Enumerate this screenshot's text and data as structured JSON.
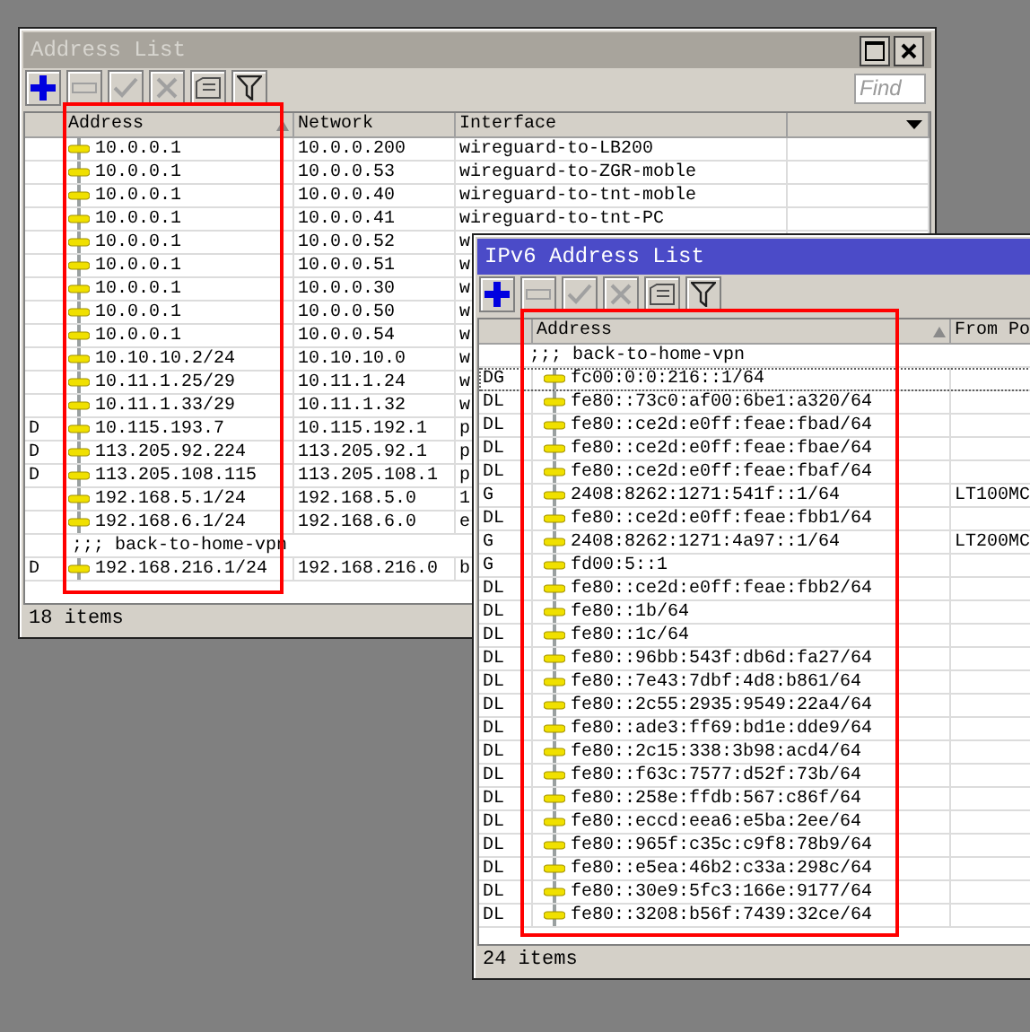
{
  "address_list": {
    "title": "Address List",
    "active": false,
    "toolbar": [
      {
        "kind": "add",
        "disabled": false
      },
      {
        "kind": "remove",
        "disabled": true
      },
      {
        "kind": "enable",
        "disabled": true
      },
      {
        "kind": "disable",
        "disabled": true
      },
      {
        "kind": "comment",
        "disabled": false
      },
      {
        "kind": "filter",
        "disabled": false
      }
    ],
    "find": {
      "placeholder": "Find"
    },
    "columns": [
      {
        "label": "Address",
        "sorted": true
      },
      {
        "label": "Network",
        "sorted": false
      },
      {
        "label": "Interface",
        "sorted": false
      }
    ],
    "rows": [
      {
        "kind": "entry",
        "address": "10.0.0.1",
        "network": "10.0.0.200",
        "interface": "wireguard-to-LB200"
      },
      {
        "kind": "entry",
        "address": "10.0.0.1",
        "network": "10.0.0.53",
        "interface": "wireguard-to-ZGR-moble"
      },
      {
        "kind": "entry",
        "address": "10.0.0.1",
        "network": "10.0.0.40",
        "interface": "wireguard-to-tnt-moble"
      },
      {
        "kind": "entry",
        "address": "10.0.0.1",
        "network": "10.0.0.41",
        "interface": "wireguard-to-tnt-PC"
      },
      {
        "kind": "entry",
        "address": "10.0.0.1",
        "network": "10.0.0.52",
        "interface": "w"
      },
      {
        "kind": "entry",
        "address": "10.0.0.1",
        "network": "10.0.0.51",
        "interface": "w"
      },
      {
        "kind": "entry",
        "address": "10.0.0.1",
        "network": "10.0.0.30",
        "interface": "w"
      },
      {
        "kind": "entry",
        "address": "10.0.0.1",
        "network": "10.0.0.50",
        "interface": "w"
      },
      {
        "kind": "entry",
        "address": "10.0.0.1",
        "network": "10.0.0.54",
        "interface": "w"
      },
      {
        "kind": "entry",
        "address": "10.10.10.2/24",
        "network": "10.10.10.0",
        "interface": "w"
      },
      {
        "kind": "entry",
        "address": "10.11.1.25/29",
        "network": "10.11.1.24",
        "interface": "w"
      },
      {
        "kind": "entry",
        "address": "10.11.1.33/29",
        "network": "10.11.1.32",
        "interface": "w"
      },
      {
        "kind": "entry",
        "flag": "D",
        "address": "10.115.193.7",
        "network": "10.115.192.1",
        "interface": "p"
      },
      {
        "kind": "entry",
        "flag": "D",
        "address": "113.205.92.224",
        "network": "113.205.92.1",
        "interface": "p"
      },
      {
        "kind": "entry",
        "flag": "D",
        "address": "113.205.108.115",
        "network": "113.205.108.1",
        "interface": "p"
      },
      {
        "kind": "entry",
        "address": "192.168.5.1/24",
        "network": "192.168.5.0",
        "interface": "1"
      },
      {
        "kind": "entry",
        "address": "192.168.6.1/24",
        "network": "192.168.6.0",
        "interface": "e"
      },
      {
        "kind": "comment",
        "text": ";;; back-to-home-vpn"
      },
      {
        "kind": "entry",
        "flag": "D",
        "address": "192.168.216.1/24",
        "network": "192.168.216.0",
        "interface": "b"
      }
    ],
    "status": "18 items"
  },
  "ipv6_address_list": {
    "title": "IPv6 Address List",
    "active": true,
    "toolbar": [
      {
        "kind": "add",
        "disabled": false
      },
      {
        "kind": "remove",
        "disabled": true
      },
      {
        "kind": "enable",
        "disabled": true
      },
      {
        "kind": "disable",
        "disabled": true
      },
      {
        "kind": "comment",
        "disabled": false
      },
      {
        "kind": "filter",
        "disabled": false
      }
    ],
    "columns": [
      {
        "label": "Address",
        "sorted": true
      },
      {
        "label": "From Po"
      }
    ],
    "rows": [
      {
        "kind": "comment",
        "text": ";;; back-to-home-vpn"
      },
      {
        "kind": "entry",
        "flag": "DG",
        "address": "fc00:0:0:216::1/64",
        "focused": true
      },
      {
        "kind": "entry",
        "flag": "DL",
        "address": "fe80::73c0:af00:6be1:a320/64",
        "focused": false
      },
      {
        "kind": "entry",
        "flag": "DL",
        "address": "fe80::ce2d:e0ff:feae:fbad/64",
        "focused": false
      },
      {
        "kind": "entry",
        "flag": "DL",
        "address": "fe80::ce2d:e0ff:feae:fbae/64",
        "focused": false
      },
      {
        "kind": "entry",
        "flag": "DL",
        "address": "fe80::ce2d:e0ff:feae:fbaf/64",
        "focused": false
      },
      {
        "kind": "entry",
        "flag": "G",
        "address": "2408:8262:1271:541f::1/64",
        "pool": "LT100MC",
        "focused": false
      },
      {
        "kind": "entry",
        "flag": "DL",
        "address": "fe80::ce2d:e0ff:feae:fbb1/64",
        "focused": false
      },
      {
        "kind": "entry",
        "flag": "G",
        "address": "2408:8262:1271:4a97::1/64",
        "pool": "LT200MC",
        "focused": false
      },
      {
        "kind": "entry",
        "flag": "G",
        "address": "fd00:5::1",
        "focused": false
      },
      {
        "kind": "entry",
        "flag": "DL",
        "address": "fe80::ce2d:e0ff:feae:fbb2/64",
        "focused": false
      },
      {
        "kind": "entry",
        "flag": "DL",
        "address": "fe80::1b/64",
        "focused": false
      },
      {
        "kind": "entry",
        "flag": "DL",
        "address": "fe80::1c/64",
        "focused": false
      },
      {
        "kind": "entry",
        "flag": "DL",
        "address": "fe80::96bb:543f:db6d:fa27/64",
        "focused": false
      },
      {
        "kind": "entry",
        "flag": "DL",
        "address": "fe80::7e43:7dbf:4d8:b861/64",
        "focused": false
      },
      {
        "kind": "entry",
        "flag": "DL",
        "address": "fe80::2c55:2935:9549:22a4/64",
        "focused": false
      },
      {
        "kind": "entry",
        "flag": "DL",
        "address": "fe80::ade3:ff69:bd1e:dde9/64",
        "focused": false
      },
      {
        "kind": "entry",
        "flag": "DL",
        "address": "fe80::2c15:338:3b98:acd4/64",
        "focused": false
      },
      {
        "kind": "entry",
        "flag": "DL",
        "address": "fe80::f63c:7577:d52f:73b/64",
        "focused": false
      },
      {
        "kind": "entry",
        "flag": "DL",
        "address": "fe80::258e:ffdb:567:c86f/64",
        "focused": false
      },
      {
        "kind": "entry",
        "flag": "DL",
        "address": "fe80::eccd:eea6:e5ba:2ee/64",
        "focused": false
      },
      {
        "kind": "entry",
        "flag": "DL",
        "address": "fe80::965f:c35c:c9f8:78b9/64",
        "focused": false
      },
      {
        "kind": "entry",
        "flag": "DL",
        "address": "fe80::e5ea:46b2:c33a:298c/64",
        "focused": false
      },
      {
        "kind": "entry",
        "flag": "DL",
        "address": "fe80::30e9:5fc3:166e:9177/64",
        "focused": false
      },
      {
        "kind": "entry",
        "flag": "DL",
        "address": "fe80::3208:b56f:7439:32ce/64",
        "focused": false
      }
    ],
    "status": "24 items"
  }
}
